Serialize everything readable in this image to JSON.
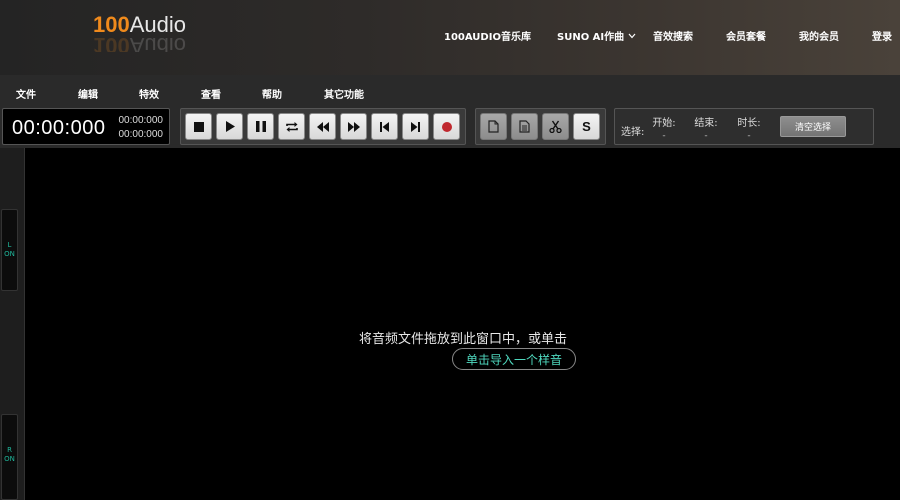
{
  "header": {
    "logo": {
      "number": "100",
      "word": "Audio"
    },
    "nav": [
      {
        "label": "100AUDIO音乐库"
      },
      {
        "label": "SUNO AI作曲"
      },
      {
        "label": "音效搜索"
      },
      {
        "label": "会员套餐"
      },
      {
        "label": "我的会员"
      },
      {
        "label": "登录"
      }
    ],
    "nav_dropdown_icon": "chevron-down-icon"
  },
  "menu": [
    {
      "label": "文件"
    },
    {
      "label": "编辑"
    },
    {
      "label": "特效"
    },
    {
      "label": "查看"
    },
    {
      "label": "帮助"
    },
    {
      "label": "其它功能"
    }
  ],
  "time": {
    "main": "00:00:000",
    "sub1": "00:00:000",
    "sub2": "00:00:000"
  },
  "transport_icons": [
    "stop-icon",
    "play-icon",
    "pause-icon",
    "loop-icon",
    "rewind-icon",
    "fast-forward-icon",
    "skip-start-icon",
    "skip-end-icon",
    "record-icon"
  ],
  "edit_icons": [
    "copy-icon",
    "paste-icon",
    "cut-icon",
    "silence-icon"
  ],
  "edit_s_label": "S",
  "selection": {
    "label": "选择:",
    "start_label": "开始:",
    "end_label": "结束:",
    "duration_label": "时长:",
    "start_value": "-",
    "end_value": "-",
    "duration_value": "-",
    "clear_label": "清空选择"
  },
  "channels": {
    "left": {
      "letter": "L",
      "status": "ON"
    },
    "right": {
      "letter": "R",
      "status": "ON"
    }
  },
  "main": {
    "drop_text": "将音频文件拖放到此窗口中，或单击",
    "sample_button": "单击导入一个样音"
  },
  "colors": {
    "logo_accent": "#f08a1c",
    "sample_text": "#4fd9bf",
    "channel_text": "#1fb59a",
    "record": "#c0282e"
  }
}
